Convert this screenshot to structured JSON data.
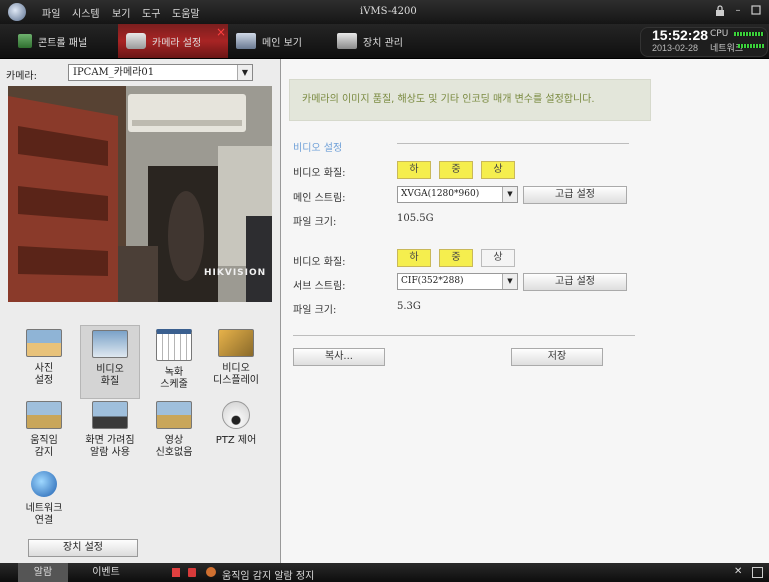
{
  "titlebar": {
    "menu": [
      "파일",
      "시스템",
      "보기",
      "도구",
      "도움말"
    ],
    "app_title": "iVMS-4200"
  },
  "tabs": [
    {
      "label": "콘트롤 패널",
      "icon": "control-panel-icon"
    },
    {
      "label": "카메라 설정",
      "icon": "camera-settings-icon"
    },
    {
      "label": "메인 보기",
      "icon": "main-view-icon"
    },
    {
      "label": "장치 관리",
      "icon": "device-management-icon"
    }
  ],
  "status": {
    "time": "15:52:28",
    "date": "2013-02-28",
    "cpu_label": "CPU",
    "network_label": "네트워크"
  },
  "left": {
    "camera_label": "카메라:",
    "camera_value": "IPCAM_카메라01",
    "watermark": "HIKVISION",
    "tools": [
      {
        "label1": "사진",
        "label2": "설정",
        "icon": "image-settings-icon"
      },
      {
        "label1": "비디오",
        "label2": "화질",
        "icon": "video-quality-icon"
      },
      {
        "label1": "녹화",
        "label2": "스케줄",
        "icon": "recording-schedule-icon"
      },
      {
        "label1": "비디오",
        "label2": "디스플레이",
        "icon": "video-display-icon"
      },
      {
        "label1": "움직임",
        "label2": "감지",
        "icon": "motion-detection-icon"
      },
      {
        "label1": "화면 가려짐",
        "label2": "알람 사용",
        "icon": "tamper-alarm-icon"
      },
      {
        "label1": "영상",
        "label2": "신호없음",
        "icon": "video-loss-icon"
      },
      {
        "label1": "PTZ 제어",
        "label2": "",
        "icon": "ptz-control-icon"
      },
      {
        "label1": "네트워크",
        "label2": "연결",
        "icon": "network-connection-icon"
      }
    ],
    "device_settings": "장치 설정"
  },
  "right": {
    "info": "카메라의 이미지 품질, 해상도 및 기타 인코딩 매개 변수를 설정합니다.",
    "section_title": "비디오 설정",
    "main": {
      "quality_label": "비디오 화질:",
      "quality_options": [
        "하",
        "중",
        "상"
      ],
      "stream_label": "메인 스트림:",
      "stream_value": "XVGA(1280*960)",
      "advanced": "고급 설정",
      "size_label": "파일 크기:",
      "size_value": "105.5G"
    },
    "sub": {
      "quality_label": "비디오 화질:",
      "quality_options": [
        "하",
        "중",
        "상"
      ],
      "stream_label": "서브 스트림:",
      "stream_value": "CIF(352*288)",
      "advanced": "고급 설정",
      "size_label": "파일 크기:",
      "size_value": "5.3G"
    },
    "copy_button": "복사...",
    "save_button": "저장"
  },
  "statusbar": {
    "tabs": [
      "알람",
      "이벤트"
    ],
    "message": "움직임 감지 알람 정지"
  },
  "colors": {
    "active_tab": "#a82424",
    "quality_selected": "#f5ee4e",
    "info_text": "#7a8a40"
  }
}
